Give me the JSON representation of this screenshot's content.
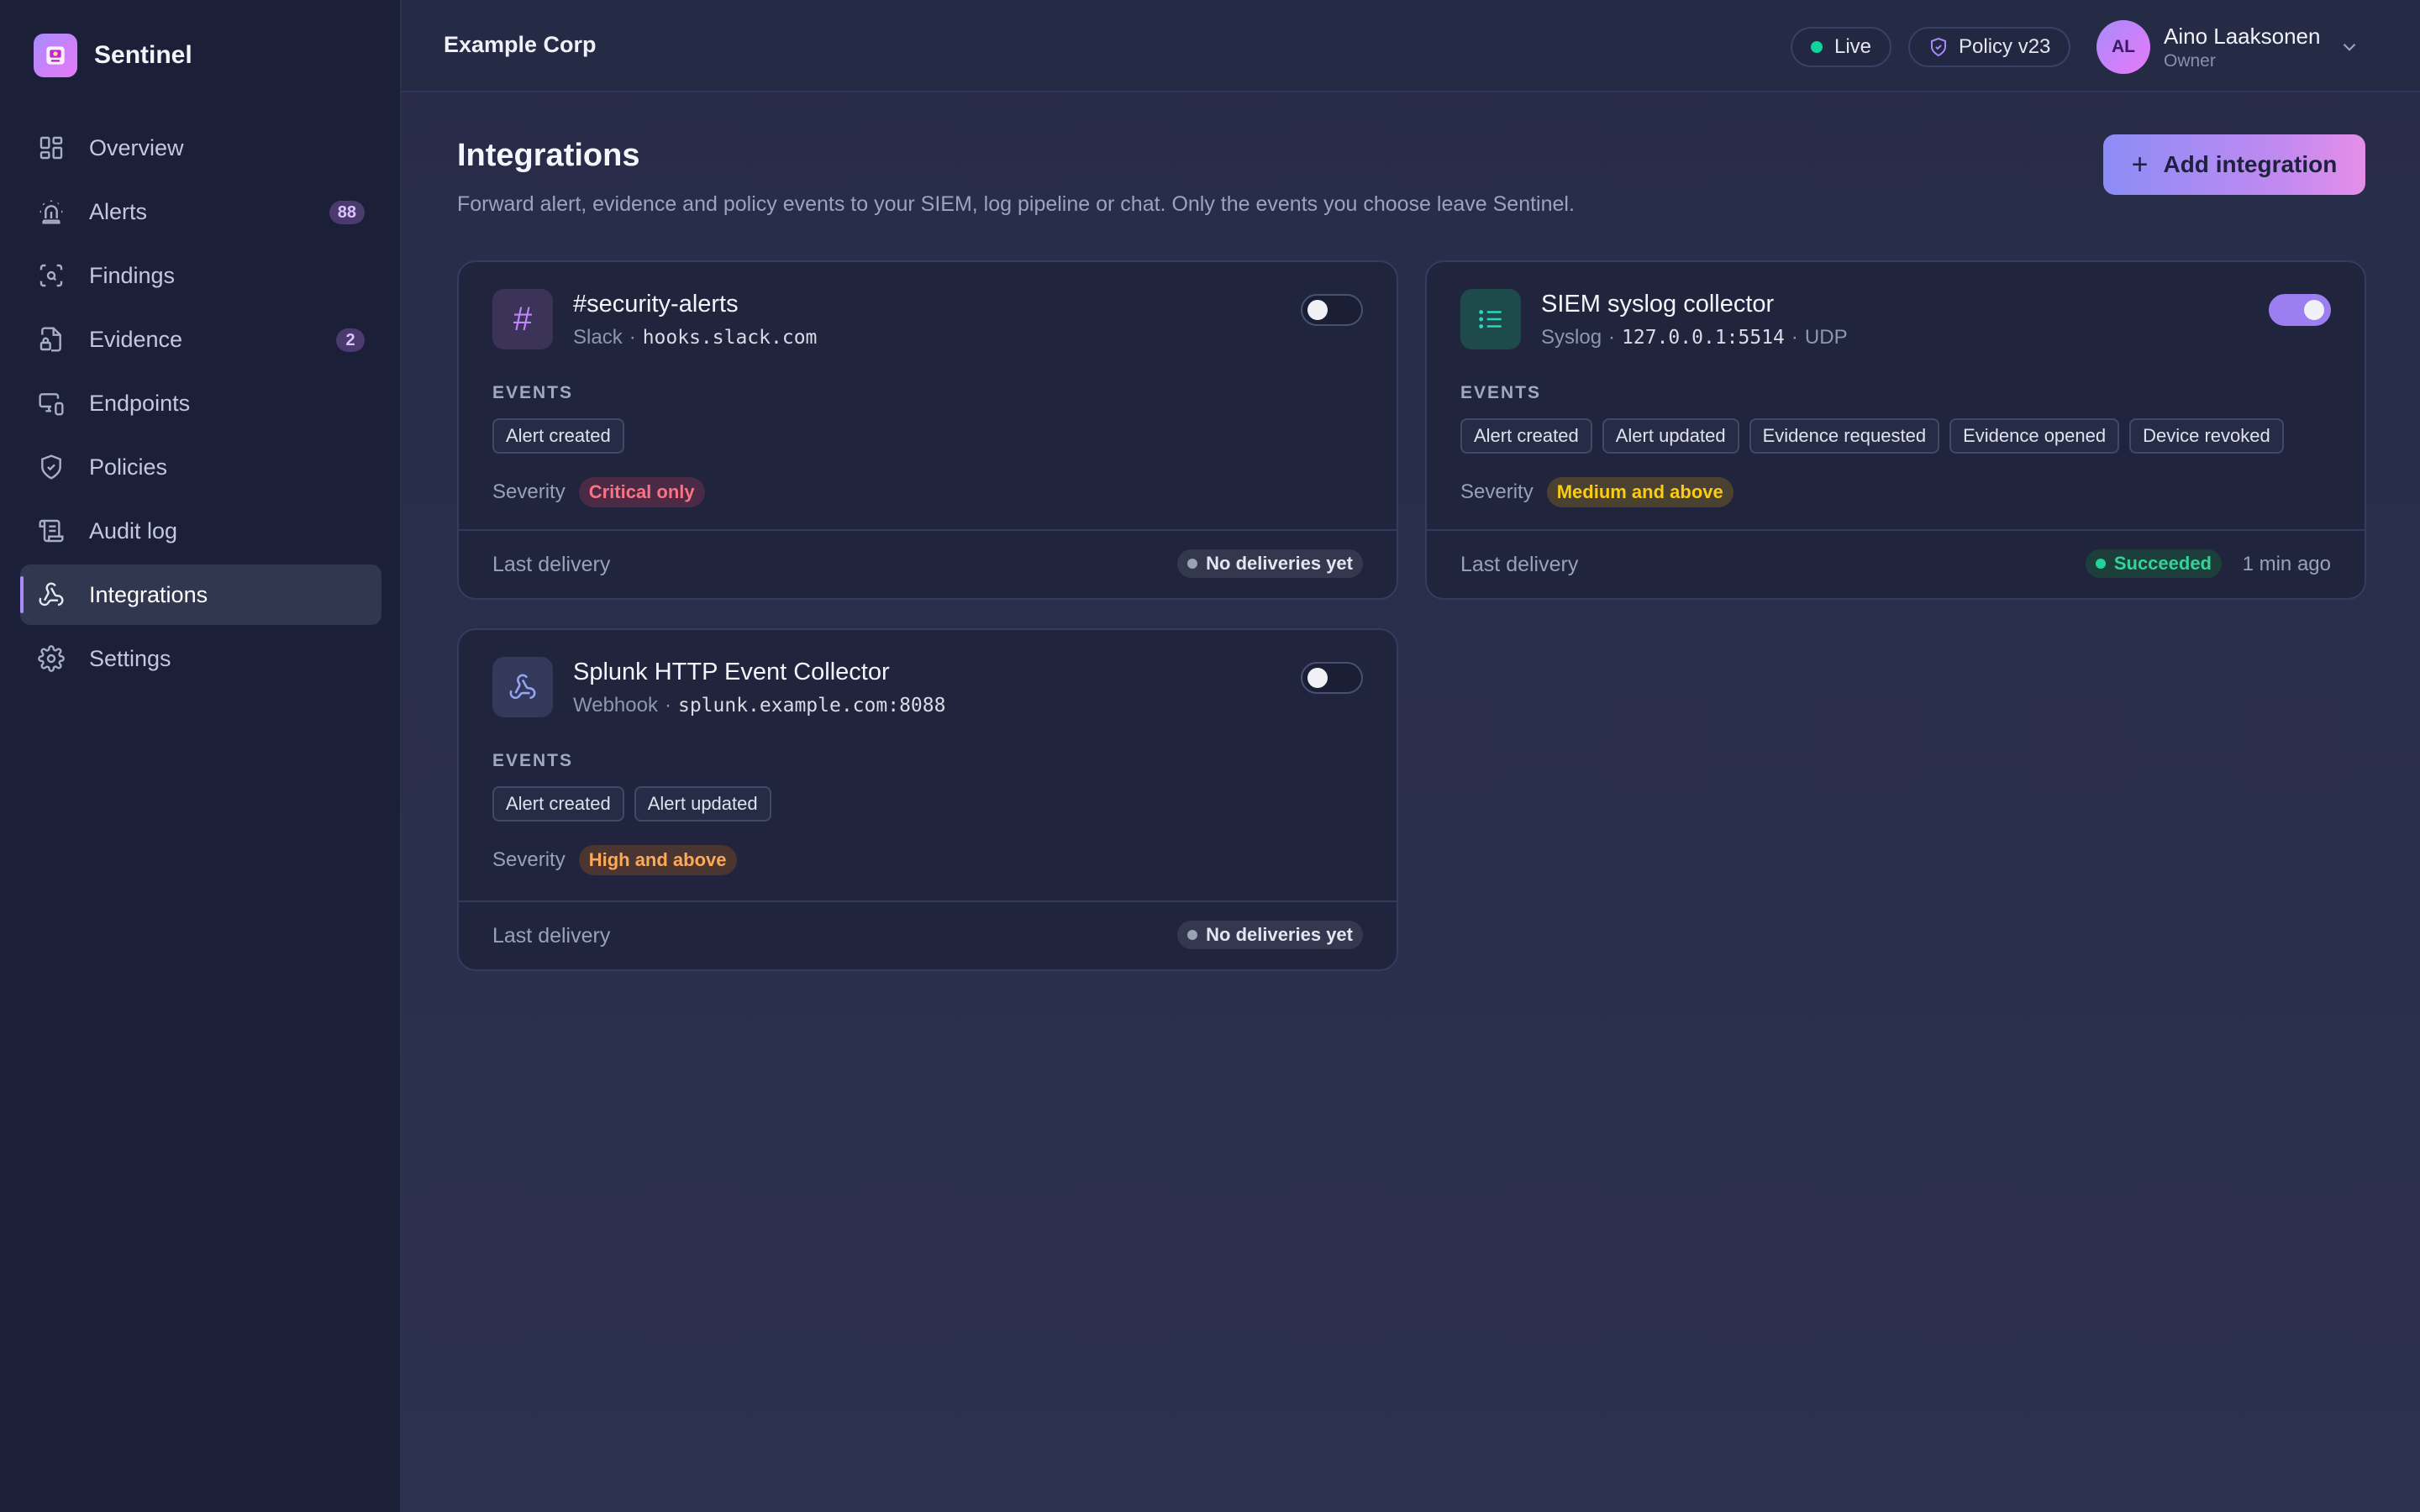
{
  "app": {
    "name": "Sentinel"
  },
  "nav": {
    "items": [
      {
        "label": "Overview",
        "icon": "grid-icon"
      },
      {
        "label": "Alerts",
        "icon": "siren-icon",
        "badge": "88"
      },
      {
        "label": "Findings",
        "icon": "scan-search-icon"
      },
      {
        "label": "Evidence",
        "icon": "file-lock-icon",
        "badge": "2"
      },
      {
        "label": "Endpoints",
        "icon": "monitor-smartphone-icon"
      },
      {
        "label": "Policies",
        "icon": "shield-check-icon"
      },
      {
        "label": "Audit log",
        "icon": "scroll-icon"
      },
      {
        "label": "Integrations",
        "icon": "webhook-icon",
        "active": true
      },
      {
        "label": "Settings",
        "icon": "gear-icon"
      }
    ]
  },
  "topbar": {
    "org": "Example Corp",
    "live_label": "Live",
    "policy_label": "Policy v23",
    "user": {
      "initials": "AL",
      "name": "Aino Laaksonen",
      "role": "Owner"
    }
  },
  "page": {
    "title": "Integrations",
    "subtitle": "Forward alert, evidence and policy events to your SIEM, log pipeline or chat. Only the events you choose leave Sentinel.",
    "add_button": "Add integration"
  },
  "labels": {
    "events": "EVENTS",
    "severity": "Severity",
    "last_delivery": "Last delivery",
    "sep": "·"
  },
  "integrations": [
    {
      "name": "#security-alerts",
      "type": "Slack",
      "target": "hooks.slack.com",
      "target_suffix": "",
      "enabled": false,
      "events": [
        "Alert created"
      ],
      "severity": "Critical only",
      "delivery_status": "No deliveries yet",
      "delivery_time": ""
    },
    {
      "name": "SIEM syslog collector",
      "type": "Syslog",
      "target": "127.0.0.1:5514",
      "target_suffix": "UDP",
      "enabled": true,
      "events": [
        "Alert created",
        "Alert updated",
        "Evidence requested",
        "Evidence opened",
        "Device revoked"
      ],
      "severity": "Medium and above",
      "delivery_status": "Succeeded",
      "delivery_time": "1 min ago"
    },
    {
      "name": "Splunk HTTP Event Collector",
      "type": "Webhook",
      "target": "splunk.example.com:8088",
      "target_suffix": "",
      "enabled": false,
      "events": [
        "Alert created",
        "Alert updated"
      ],
      "severity": "High and above",
      "delivery_status": "No deliveries yet",
      "delivery_time": ""
    }
  ],
  "colors": {
    "accent": "#a78bfa",
    "live": "#10d39a",
    "critical": "#fb7185",
    "medium": "#facc15",
    "high": "#fbaa5a",
    "success": "#34d399"
  }
}
